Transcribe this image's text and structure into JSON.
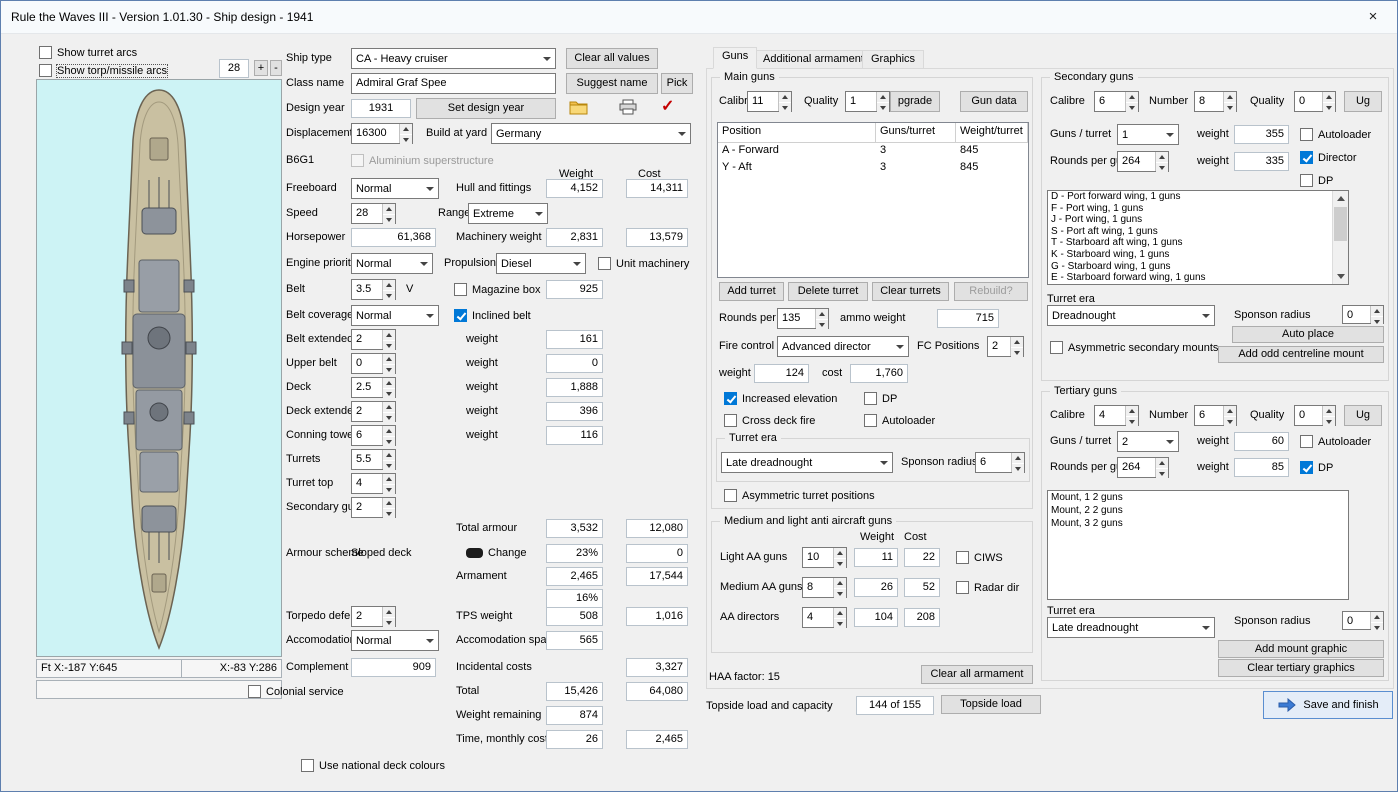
{
  "titlebar": {
    "title": "Rule the Waves III - Version 1.01.30 - Ship design - 1941",
    "close": "×"
  },
  "left": {
    "show_turret_arcs": "Show turret arcs",
    "show_torp_arcs": "Show torp/missile arcs",
    "zoom": "28",
    "plus": "+",
    "minus": "-",
    "coords_left": "Ft X:-187 Y:645",
    "coords_right": "X:-83 Y:286"
  },
  "mid": {
    "ship_type_label": "Ship type",
    "ship_type": "CA - Heavy cruiser",
    "clear_all_values": "Clear all values",
    "class_name_label": "Class name",
    "class_name": "Admiral Graf Spee",
    "suggest_name": "Suggest name",
    "pick": "Pick",
    "design_year_label": "Design year",
    "design_year": "1931",
    "set_design_year": "Set design year",
    "displacement_label": "Displacement",
    "displacement": "16300",
    "build_at_yard_label": "Build at yard",
    "build_at_yard": "Germany",
    "hull_code": "B6G1",
    "aluminium_label": "Aluminium superstructure",
    "weight_header": "Weight",
    "cost_header": "Cost",
    "freeboard_label": "Freeboard",
    "freeboard": "Normal",
    "hull_fittings_label": "Hull and fittings",
    "hull_weight": "4,152",
    "hull_cost": "14,311",
    "speed_label": "Speed",
    "speed": "28",
    "range_label": "Range",
    "range": "Extreme",
    "horsepower_label": "Horsepower",
    "horsepower": "61,368",
    "machinery_label": "Machinery weight",
    "machinery_weight": "2,831",
    "machinery_cost": "13,579",
    "engine_priority_label": "Engine priority",
    "engine_priority": "Normal",
    "propulsion_label": "Propulsion",
    "propulsion": "Diesel",
    "unit_machinery_label": "Unit machinery",
    "belt_label": "Belt",
    "belt": "3.5",
    "belt_v": "V",
    "magazine_box_label": "Magazine box",
    "belt_weight": "925",
    "belt_coverage_label": "Belt coverage",
    "belt_coverage": "Normal",
    "inclined_belt_label": "Inclined belt",
    "armour_rows": [
      {
        "label": "Belt extended",
        "value": "2",
        "wlabel": "weight",
        "weight": "161"
      },
      {
        "label": "Upper belt",
        "value": "0",
        "wlabel": "weight",
        "weight": "0"
      },
      {
        "label": "Deck",
        "value": "2.5",
        "wlabel": "weight",
        "weight": "1,888"
      },
      {
        "label": "Deck extended",
        "value": "2",
        "wlabel": "weight",
        "weight": "396"
      },
      {
        "label": "Conning tower",
        "value": "6",
        "wlabel": "weight",
        "weight": "116"
      }
    ],
    "spin_rows": [
      {
        "label": "Turrets",
        "value": "5.5"
      },
      {
        "label": "Turret top",
        "value": "4"
      },
      {
        "label": "Secondary guns",
        "value": "2"
      }
    ],
    "total_armour_label": "Total armour",
    "total_armour_weight": "3,532",
    "total_armour_cost": "12,080",
    "armour_scheme_label": "Armour scheme",
    "armour_scheme": "Sloped deck",
    "change_label": "Change",
    "armour_pct": "23%",
    "armour_pct_cost": "0",
    "armament_label": "Armament",
    "armament_weight": "2,465",
    "armament_cost": "17,544",
    "armament_pct": "16%",
    "torpedo_defence_label": "Torpedo defence",
    "torpedo_defence": "2",
    "tps_label": "TPS weight",
    "tps_weight": "508",
    "tps_cost": "1,016",
    "accomodation_label": "Accomodation",
    "accomodation": "Normal",
    "accomodation_space_label": "Accomodation space",
    "accomodation_space": "565",
    "complement_label": "Complement",
    "complement": "909",
    "incidental_label": "Incidental costs",
    "incidental_cost": "3,327",
    "total_label": "Total",
    "total_weight": "15,426",
    "total_cost": "64,080",
    "weight_remaining_label": "Weight remaining",
    "weight_remaining": "874",
    "time_label": "Time, monthly cost",
    "time_weight": "26",
    "time_cost": "2,465",
    "colonial_label": "Colonial service",
    "national_deck_label": "Use national deck colours"
  },
  "tabs": {
    "guns": "Guns",
    "additional": "Additional armament",
    "graphics": "Graphics"
  },
  "main_guns": {
    "group_title": "Main guns",
    "calibre_label": "Calibre",
    "calibre": "11",
    "quality_label": "Quality",
    "quality": "1",
    "upgrade_label": "pgrade",
    "gun_data_label": "Gun data",
    "table": {
      "headers": [
        "Position",
        "Guns/turret",
        "Weight/turret"
      ],
      "rows": [
        {
          "position": "A - Forward",
          "guns": "3",
          "weight": "845"
        },
        {
          "position": "Y - Aft",
          "guns": "3",
          "weight": "845"
        }
      ]
    },
    "add_turret": "Add turret",
    "delete_turret": "Delete turret",
    "clear_turrets": "Clear turrets",
    "rebuild": "Rebuild?",
    "rounds_label": "Rounds per gun",
    "rounds": "135",
    "ammo_weight_label": "ammo weight",
    "ammo_weight": "715",
    "fire_control_label": "Fire control",
    "fire_control": "Advanced director",
    "fc_positions_label": "FC Positions",
    "fc_positions": "2",
    "weight_label": "weight",
    "weight": "124",
    "cost_label": "cost",
    "cost": "1,760",
    "increased_elevation_label": "Increased elevation",
    "dp_label": "DP",
    "cross_deck_label": "Cross deck fire",
    "autoloader_label": "Autoloader",
    "turret_era_label": "Turret era",
    "turret_era": "Late dreadnought",
    "sponson_label": "Sponson radius",
    "sponson": "6",
    "asymmetric_label": "Asymmetric turret positions"
  },
  "aa": {
    "group_title": "Medium and light anti aircraft guns",
    "weight_header": "Weight",
    "cost_header": "Cost",
    "light_label": "Light AA guns",
    "light": "10",
    "light_weight": "11",
    "light_cost": "22",
    "ciws_label": "CIWS",
    "medium_label": "Medium AA guns",
    "medium": "8",
    "medium_weight": "26",
    "medium_cost": "52",
    "radar_label": "Radar dir",
    "directors_label": "AA directors",
    "directors": "4",
    "directors_weight": "104",
    "directors_cost": "208"
  },
  "secondary": {
    "group_title": "Secondary guns",
    "calibre_label": "Calibre",
    "calibre": "6",
    "number_label": "Number",
    "number": "8",
    "quality_label": "Quality",
    "quality": "0",
    "upgrade_label": "Ug",
    "guns_turret_label": "Guns / turret",
    "guns_turret": "1",
    "weight_label": "weight",
    "mount_weight": "355",
    "rounds_label": "Rounds per gun",
    "rounds": "264",
    "ammo_weight": "335",
    "autoloader_label": "Autoloader",
    "director_label": "Director",
    "dp_label": "DP",
    "positions": [
      "D - Port forward wing, 1 guns",
      "F - Port wing, 1 guns",
      "J - Port wing, 1 guns",
      "S - Port aft wing, 1 guns",
      "T - Starboard aft wing, 1 guns",
      "K - Starboard wing, 1 guns",
      "G - Starboard wing, 1 guns",
      "E - Starboard forward wing, 1 guns"
    ],
    "turret_era_label": "Turret era",
    "turret_era": "Dreadnought",
    "sponson_label": "Sponson radius",
    "sponson": "0",
    "auto_place": "Auto place",
    "asymmetric_label": "Asymmetric secondary mounts",
    "add_odd": "Add odd centreline mount"
  },
  "tertiary": {
    "group_title": "Tertiary guns",
    "calibre_label": "Calibre",
    "calibre": "4",
    "number_label": "Number",
    "number": "6",
    "quality_label": "Quality",
    "quality": "0",
    "upgrade_label": "Ug",
    "guns_turret_label": "Guns / turret",
    "guns_turret": "2",
    "weight_label": "weight",
    "mount_weight": "60",
    "rounds_label": "Rounds per gun",
    "rounds": "264",
    "ammo_weight": "85",
    "autoloader_label": "Autoloader",
    "dp_label": "DP",
    "mounts": [
      "Mount, 1 2 guns",
      "Mount, 2 2 guns",
      "Mount, 3 2 guns"
    ],
    "turret_era_label": "Turret era",
    "turret_era": "Late dreadnought",
    "sponson_label": "Sponson radius",
    "sponson": "0",
    "add_mount_graphic": "Add mount graphic",
    "clear_tertiary_graphics": "Clear tertiary graphics"
  },
  "footer": {
    "haa_factor": "HAA factor: 15",
    "clear_all_armament": "Clear all armament",
    "topside_label": "Topside load and capacity",
    "topside_value": "144 of 155",
    "topside_button": "Topside load",
    "save_finish": "Save and finish",
    "red_check": "✓"
  }
}
